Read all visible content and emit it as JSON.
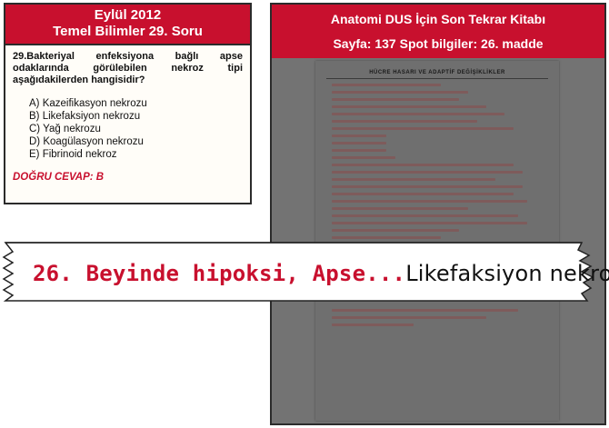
{
  "question": {
    "header_line1": "Eylül 2012",
    "header_line2": "Temel Bilimler 29. Soru",
    "text": "29.Bakteriyal enfeksiyona bağlı apse odaklarında görülebilen nekroz tipi aşağıdakilerden hangisidir?",
    "options": [
      "A) Kazeifikasyon nekrozu",
      "B) Likefaksiyon nekrozu",
      "C) Yağ nekrozu",
      "D) Koagülasyon nekrozu",
      "E) Fibrinoid nekroz"
    ],
    "answer": "DOĞRU CEVAP: B"
  },
  "book": {
    "header_line1": "Anatomi DUS İçin Son Tekrar Kitabı",
    "header_line2": "Sayfa: 137 Spot bilgiler: 26. madde",
    "page_title": "HÜCRE HASARI VE ADAPTİF DEĞİŞİKLİKLER"
  },
  "ribbon": {
    "red_text": "26. Beyinde hipoksi, Apse...",
    "black_text": "Likefaksiyon nekrozu"
  }
}
